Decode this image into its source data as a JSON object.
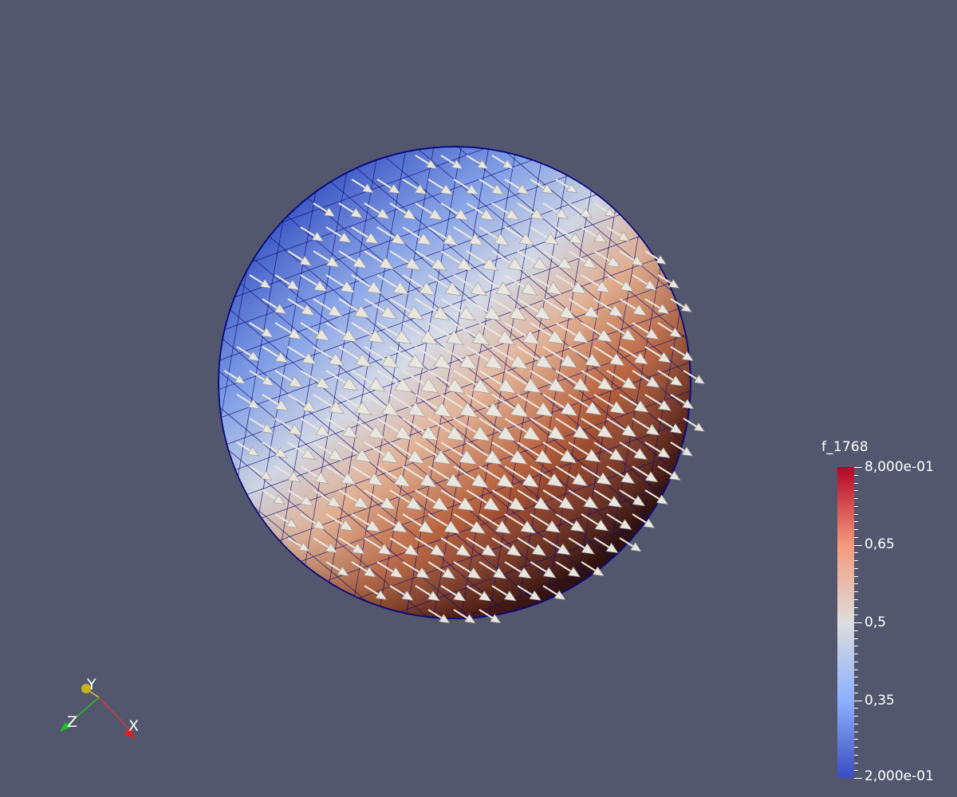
{
  "scalar_bar": {
    "title": "f_1768",
    "max_label": "8,000e-01",
    "min_label": "2,000e-01",
    "tick_labels": [
      "0,65",
      "0,5",
      "0,35"
    ],
    "colors": {
      "low": "#3b4cc0",
      "mid": "#dddddd",
      "high": "#b40426"
    }
  },
  "orientation_axes": {
    "x_label": "X",
    "y_label": "Y",
    "z_label": "Z"
  },
  "background_color": "#52576e",
  "sphere": {
    "colormap": "cool-to-warm",
    "glyph_color": "#e8e6df",
    "edge_color": "#0a0a7a"
  }
}
